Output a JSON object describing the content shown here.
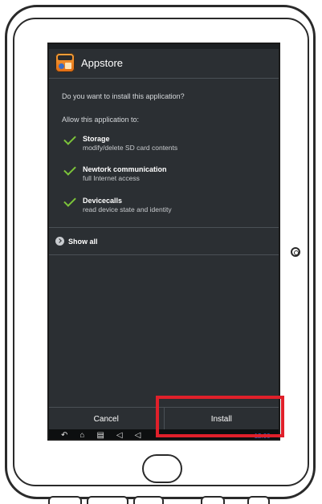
{
  "dialog": {
    "app_name": "Appstore",
    "question": "Do you want to install this application?",
    "allow_label": "Allow this application to:",
    "permissions": [
      {
        "title": "Storage",
        "desc": "modify/delete SD card contents"
      },
      {
        "title": "Newtork communication",
        "desc": "full Internet access"
      },
      {
        "title": "Devicecalls",
        "desc": "read device state and identity"
      }
    ],
    "show_all_label": "Show all",
    "cancel_label": "Cancel",
    "install_label": "Install"
  },
  "navbar": {
    "back_icon": "back-icon",
    "home_icon": "home-icon",
    "recents_icon": "recents-icon",
    "volume_down_icon": "volume-down-icon",
    "volume_up_icon": "volume-up-icon",
    "clock": "12:00"
  },
  "colors": {
    "screen_bg": "#2b2f33",
    "check_green": "#7cc43a",
    "highlight_red": "#e0202a",
    "clock_blue": "#2a64d6"
  }
}
